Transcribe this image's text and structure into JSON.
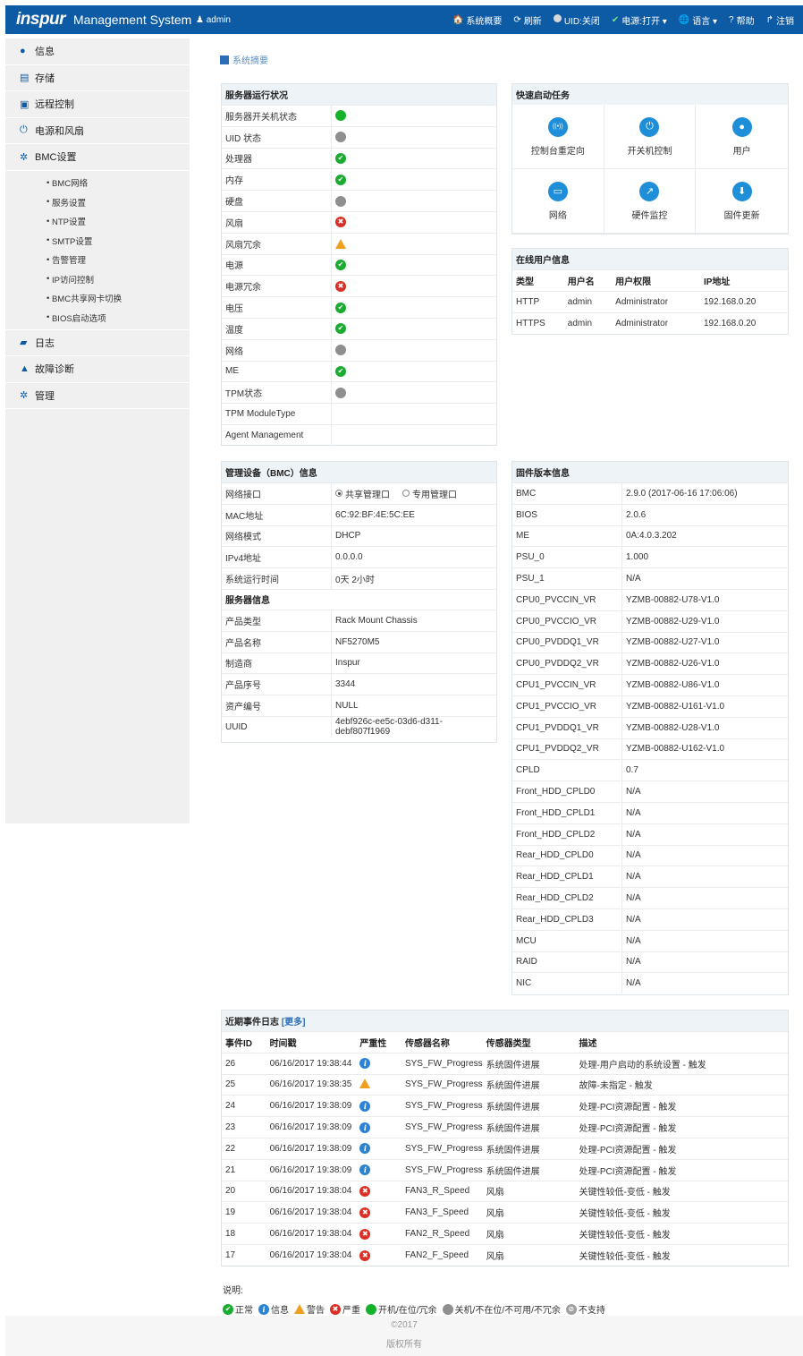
{
  "header": {
    "logo": "inspur",
    "title": "Management System",
    "user": "admin",
    "nav": [
      {
        "icon": "home-icon",
        "glyph": "🏠",
        "label": "系统概要"
      },
      {
        "icon": "refresh-icon",
        "glyph": "⟳",
        "label": "刷新"
      },
      {
        "icon": "uid-status-icon",
        "glyph": "",
        "label": "UID:关闭"
      },
      {
        "icon": "check-icon",
        "glyph": "✔",
        "label": "电源:打开 ▾"
      },
      {
        "icon": "globe-icon",
        "glyph": "🌐",
        "label": "语言 ▾"
      },
      {
        "icon": "help-icon",
        "glyph": "?",
        "label": "帮助"
      },
      {
        "icon": "logout-icon",
        "glyph": "↱",
        "label": "注销"
      }
    ]
  },
  "sidebar": {
    "items": [
      {
        "icon": "info-icon",
        "glyph": "●",
        "label": "信息"
      },
      {
        "icon": "storage-icon",
        "glyph": "▤",
        "label": "存储"
      },
      {
        "icon": "remote-control-icon",
        "glyph": "▣",
        "label": "远程控制"
      },
      {
        "icon": "power-icon",
        "glyph": "⏻",
        "label": "电源和风扇"
      },
      {
        "icon": "gear-icon",
        "glyph": "✲",
        "label": "BMC设置"
      }
    ],
    "sub_items": [
      "BMC网络",
      "服务设置",
      "NTP设置",
      "SMTP设置",
      "告警管理",
      "IP访问控制",
      "BMC共享网卡切换",
      "BIOS启动选项"
    ],
    "items2": [
      {
        "icon": "log-icon",
        "glyph": "▰",
        "label": "日志"
      },
      {
        "icon": "warning-icon",
        "glyph": "▲",
        "label": "故障诊断"
      },
      {
        "icon": "manage-icon",
        "glyph": "✲",
        "label": "管理"
      }
    ]
  },
  "breadcrumb": "系统摘要",
  "server_status": {
    "title": "服务器运行状况",
    "rows": [
      {
        "label": "服务器开关机状态",
        "status": "on"
      },
      {
        "label": "UID 状态",
        "status": "off"
      },
      {
        "label": "处理器",
        "status": "ok"
      },
      {
        "label": "内存",
        "status": "ok"
      },
      {
        "label": "硬盘",
        "status": "off"
      },
      {
        "label": "风扇",
        "status": "crit"
      },
      {
        "label": "风扇冗余",
        "status": "warn"
      },
      {
        "label": "电源",
        "status": "ok"
      },
      {
        "label": "电源冗余",
        "status": "crit"
      },
      {
        "label": "电压",
        "status": "ok"
      },
      {
        "label": "温度",
        "status": "ok"
      },
      {
        "label": "网络",
        "status": "off"
      },
      {
        "label": "ME",
        "status": "ok"
      },
      {
        "label": "TPM状态",
        "status": "off"
      },
      {
        "label": "TPM ModuleType",
        "status": "none"
      },
      {
        "label": "Agent Management",
        "status": "none"
      }
    ]
  },
  "quick_tasks": {
    "title": "快速启动任务",
    "items": [
      {
        "icon": "console-redirect-icon",
        "glyph": "((•))",
        "label": "控制台重定向"
      },
      {
        "icon": "power-control-icon",
        "glyph": "⏻",
        "label": "开关机控制"
      },
      {
        "icon": "user-icon",
        "glyph": "●",
        "label": "用户"
      },
      {
        "icon": "network-icon",
        "glyph": "▭",
        "label": "网络"
      },
      {
        "icon": "hardware-monitor-icon",
        "glyph": "↗",
        "label": "硬件监控"
      },
      {
        "icon": "firmware-update-icon",
        "glyph": "⬇",
        "label": "固件更新"
      }
    ]
  },
  "online_users": {
    "title": "在线用户信息",
    "headers": [
      "类型",
      "用户名",
      "用户权限",
      "IP地址"
    ],
    "rows": [
      [
        "HTTP",
        "admin",
        "Administrator",
        "192.168.0.20"
      ],
      [
        "HTTPS",
        "admin",
        "Administrator",
        "192.168.0.20"
      ]
    ]
  },
  "bmc_info": {
    "title": "管理设备（BMC）信息",
    "net_label": "网络接口",
    "net_opt1": "共享管理口",
    "net_opt2": "专用管理口",
    "rows": [
      [
        "MAC地址",
        "6C:92:BF:4E:5C:EE"
      ],
      [
        "网络模式",
        "DHCP"
      ],
      [
        "IPv4地址",
        "0.0.0.0"
      ],
      [
        "系统运行时间",
        "0天 2小时"
      ]
    ],
    "server_title": "服务器信息",
    "server_rows": [
      [
        "产品类型",
        "Rack Mount Chassis"
      ],
      [
        "产品名称",
        "NF5270M5"
      ],
      [
        "制造商",
        "Inspur"
      ],
      [
        "产品序号",
        "3344"
      ],
      [
        "资产编号",
        "NULL"
      ],
      [
        "UUID",
        "4ebf926c-ee5c-03d6-d311-debf807f1969"
      ]
    ]
  },
  "firmware": {
    "title": "固件版本信息",
    "rows": [
      [
        "BMC",
        "2.9.0 (2017-06-16 17:06:06)"
      ],
      [
        "BIOS",
        "2.0.6"
      ],
      [
        "ME",
        "0A:4.0.3.202"
      ],
      [
        "PSU_0",
        "1.000"
      ],
      [
        "PSU_1",
        "N/A"
      ],
      [
        "CPU0_PVCCIN_VR",
        "YZMB-00882-U78-V1.0"
      ],
      [
        "CPU0_PVCCIO_VR",
        "YZMB-00882-U29-V1.0"
      ],
      [
        "CPU0_PVDDQ1_VR",
        "YZMB-00882-U27-V1.0"
      ],
      [
        "CPU0_PVDDQ2_VR",
        "YZMB-00882-U26-V1.0"
      ],
      [
        "CPU1_PVCCIN_VR",
        "YZMB-00882-U86-V1.0"
      ],
      [
        "CPU1_PVCCIO_VR",
        "YZMB-00882-U161-V1.0"
      ],
      [
        "CPU1_PVDDQ1_VR",
        "YZMB-00882-U28-V1.0"
      ],
      [
        "CPU1_PVDDQ2_VR",
        "YZMB-00882-U162-V1.0"
      ],
      [
        "CPLD",
        "0.7"
      ],
      [
        "Front_HDD_CPLD0",
        "N/A"
      ],
      [
        "Front_HDD_CPLD1",
        "N/A"
      ],
      [
        "Front_HDD_CPLD2",
        "N/A"
      ],
      [
        "Rear_HDD_CPLD0",
        "N/A"
      ],
      [
        "Rear_HDD_CPLD1",
        "N/A"
      ],
      [
        "Rear_HDD_CPLD2",
        "N/A"
      ],
      [
        "Rear_HDD_CPLD3",
        "N/A"
      ],
      [
        "MCU",
        "N/A"
      ],
      [
        "RAID",
        "N/A"
      ],
      [
        "NIC",
        "N/A"
      ]
    ]
  },
  "events": {
    "title": "近期事件日志",
    "more": "[更多]",
    "headers": [
      "事件ID",
      "时间戳",
      "严重性",
      "传感器名称",
      "传感器类型",
      "描述"
    ],
    "rows": [
      {
        "id": "26",
        "time": "06/16/2017 19:38:44",
        "sev": "info",
        "sensor": "SYS_FW_Progress",
        "type": "系统固件进展",
        "desc": "处理-用户启动的系统设置 - 触发"
      },
      {
        "id": "25",
        "time": "06/16/2017 19:38:35",
        "sev": "warn",
        "sensor": "SYS_FW_Progress",
        "type": "系统固件进展",
        "desc": "故障-未指定 - 触发"
      },
      {
        "id": "24",
        "time": "06/16/2017 19:38:09",
        "sev": "info",
        "sensor": "SYS_FW_Progress",
        "type": "系统固件进展",
        "desc": "处理-PCI资源配置 - 触发"
      },
      {
        "id": "23",
        "time": "06/16/2017 19:38:09",
        "sev": "info",
        "sensor": "SYS_FW_Progress",
        "type": "系统固件进展",
        "desc": "处理-PCI资源配置 - 触发"
      },
      {
        "id": "22",
        "time": "06/16/2017 19:38:09",
        "sev": "info",
        "sensor": "SYS_FW_Progress",
        "type": "系统固件进展",
        "desc": "处理-PCI资源配置 - 触发"
      },
      {
        "id": "21",
        "time": "06/16/2017 19:38:09",
        "sev": "info",
        "sensor": "SYS_FW_Progress",
        "type": "系统固件进展",
        "desc": "处理-PCI资源配置 - 触发"
      },
      {
        "id": "20",
        "time": "06/16/2017 19:38:04",
        "sev": "crit",
        "sensor": "FAN3_R_Speed",
        "type": "风扇",
        "desc": "关键性较低-变低 - 触发"
      },
      {
        "id": "19",
        "time": "06/16/2017 19:38:04",
        "sev": "crit",
        "sensor": "FAN3_F_Speed",
        "type": "风扇",
        "desc": "关键性较低-变低 - 触发"
      },
      {
        "id": "18",
        "time": "06/16/2017 19:38:04",
        "sev": "crit",
        "sensor": "FAN2_R_Speed",
        "type": "风扇",
        "desc": "关键性较低-变低 - 触发"
      },
      {
        "id": "17",
        "time": "06/16/2017 19:38:04",
        "sev": "crit",
        "sensor": "FAN2_F_Speed",
        "type": "风扇",
        "desc": "关键性较低-变低 - 触发"
      }
    ]
  },
  "legend": {
    "title": "说明:",
    "items": [
      {
        "status": "ok",
        "label": "正常"
      },
      {
        "status": "info",
        "label": "信息"
      },
      {
        "status": "warn",
        "label": "警告"
      },
      {
        "status": "crit",
        "label": "严重"
      },
      {
        "status": "on",
        "label": "开机/在位/冗余"
      },
      {
        "status": "off",
        "label": "关机/不在位/不可用/不冗余"
      },
      {
        "status": "ns",
        "label": "不支持"
      }
    ]
  },
  "footer": {
    "copyright": "©2017",
    "rights": "版权所有"
  },
  "colors": {
    "header_bg": "#0e5ba5",
    "ok": "#1aab2f",
    "crit": "#d93025",
    "warn": "#f0a020",
    "info": "#2a84d2"
  }
}
